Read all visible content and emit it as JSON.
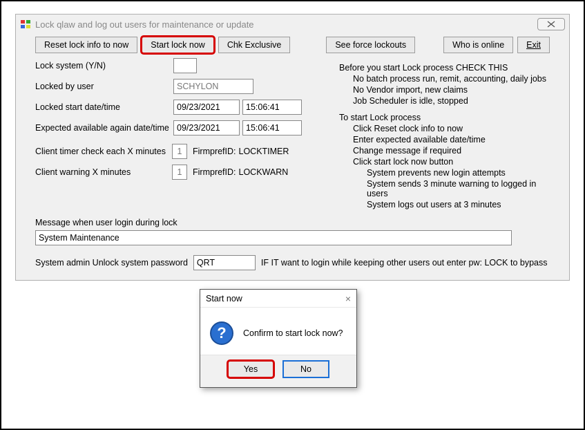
{
  "window": {
    "title": "Lock qlaw and log out users for maintenance or update"
  },
  "toolbar": {
    "reset": "Reset lock info to now",
    "start": "Start lock now",
    "chk": "Chk Exclusive",
    "see": "See force lockouts",
    "who": "Who is online",
    "exit": "Exit"
  },
  "labels": {
    "lock_system": "Lock system (Y/N)",
    "locked_by": "Locked by user",
    "locked_start": "Locked start date/time",
    "expected": "Expected available again date/time",
    "client_timer": "Client timer check each X minutes",
    "client_warn": "Client warning X minutes",
    "firmpref": "FirmprefID:",
    "firmpref_timer": "LOCKTIMER",
    "firmpref_warn": "LOCKWARN",
    "msg_when": "Message when user login during lock",
    "admin_unlock": "System admin Unlock system password",
    "admin_note": "IF IT want to login while keeping other users out enter pw: LOCK to bypass"
  },
  "values": {
    "locked_by_user": "SCHYLON",
    "start_date": "09/23/2021",
    "start_time": "15:06:41",
    "expected_date": "09/23/2021",
    "expected_time": "15:06:41",
    "timer_minutes": "1",
    "warn_minutes": "1",
    "login_message": "System Maintenance",
    "admin_pw": "QRT"
  },
  "info": {
    "h1": "Before you start Lock process CHECK THIS",
    "l1": "No batch process run, remit, accounting, daily jobs",
    "l2": "No Vendor import, new claims",
    "l3": "Job Scheduler is idle, stopped",
    "h2": "To start Lock process",
    "s1": "Click Reset clock info to now",
    "s2": "Enter expected available date/time",
    "s3": "Change message if required",
    "s4": "Click start lock now button",
    "s4a": "System prevents new login attempts",
    "s4b": "System sends 3 minute warning to logged in users",
    "s4c": "System logs out users at 3 minutes"
  },
  "dialog": {
    "title": "Start now",
    "body": "Confirm to start lock now?",
    "yes": "Yes",
    "no": "No"
  }
}
